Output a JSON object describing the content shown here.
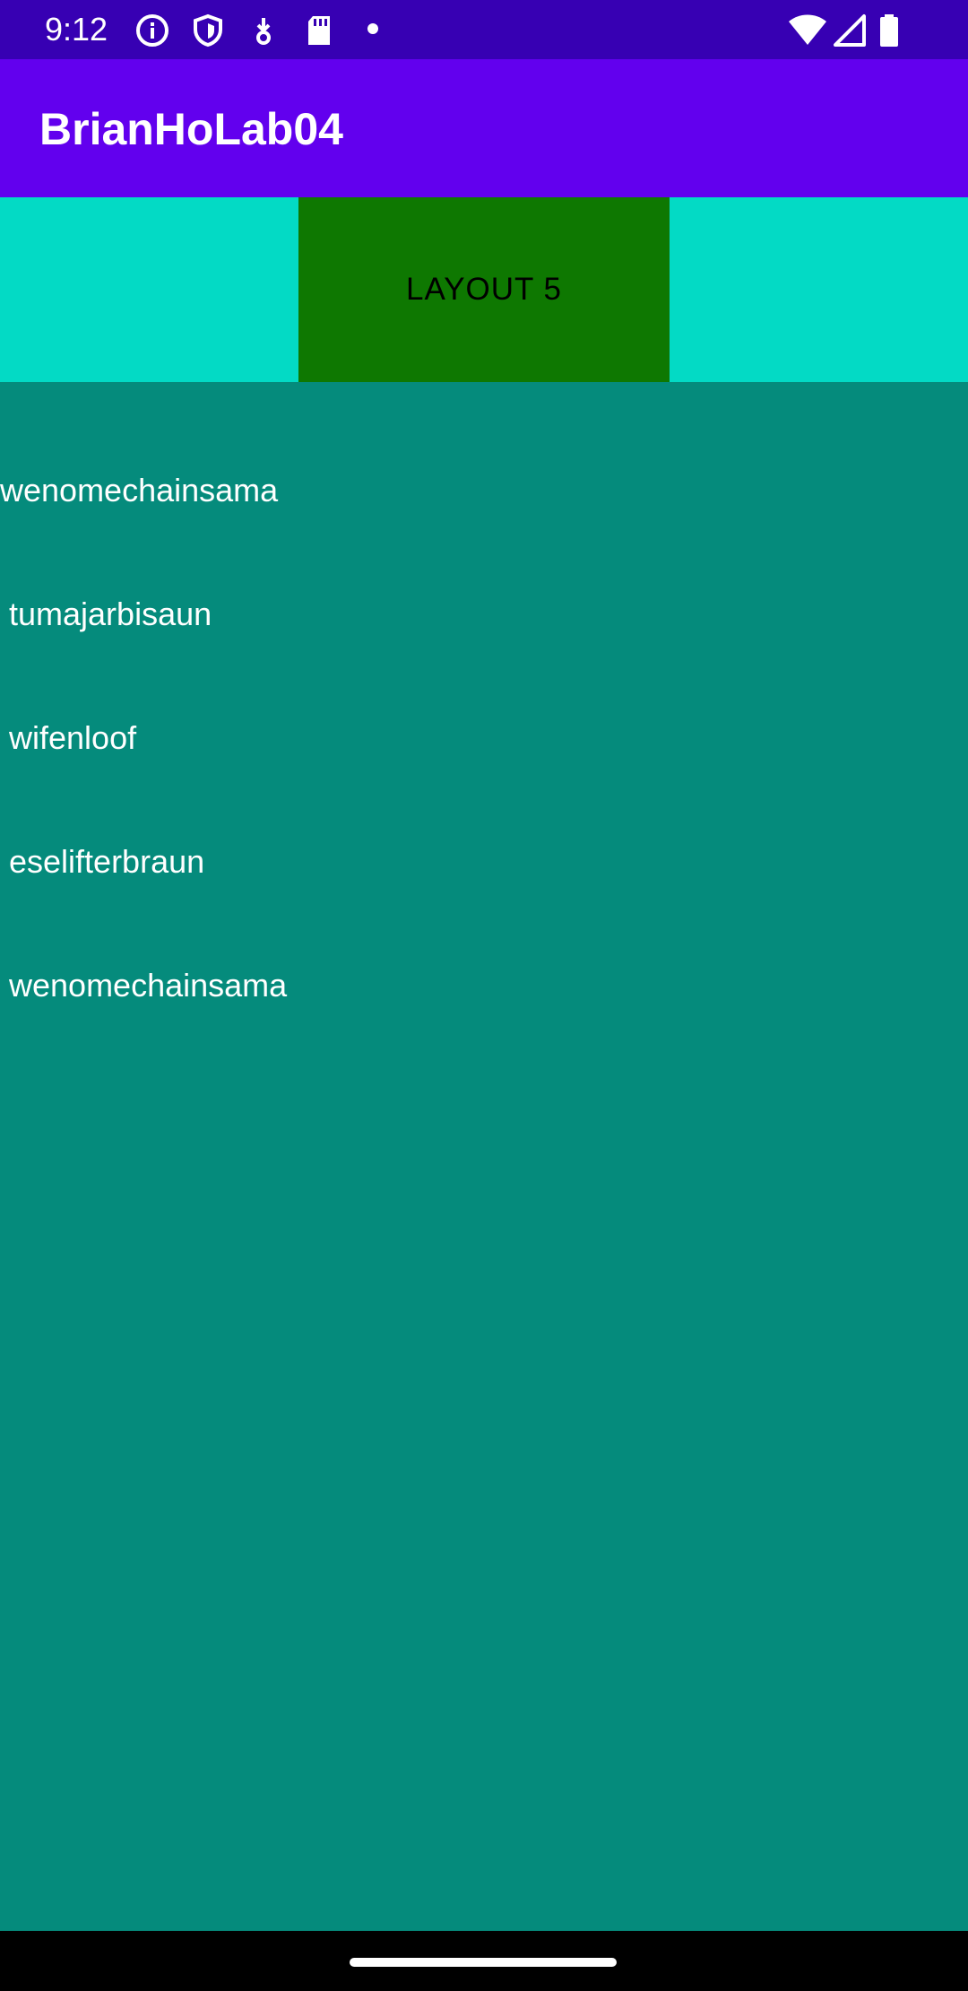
{
  "status_bar": {
    "time": "9:12",
    "icons_left": [
      "info-icon",
      "shield-icon",
      "download-icon",
      "sd-card-icon",
      "dot-icon"
    ],
    "icons_right": [
      "wifi-icon",
      "signal-icon",
      "battery-icon"
    ]
  },
  "app_bar": {
    "title": "BrianHoLab04"
  },
  "top_strip": {
    "button_label": "LAYOUT 5"
  },
  "content": {
    "lines": [
      "wenomechainsama",
      " tumajarbisaun",
      " wifenloof",
      " eselifterbraun",
      " wenomechainsama"
    ]
  },
  "colors": {
    "status_bar": "#3700b3",
    "app_bar": "#6200ee",
    "strip": "#03dac5",
    "button": "#0e7801",
    "content_bg": "#058b7c"
  }
}
